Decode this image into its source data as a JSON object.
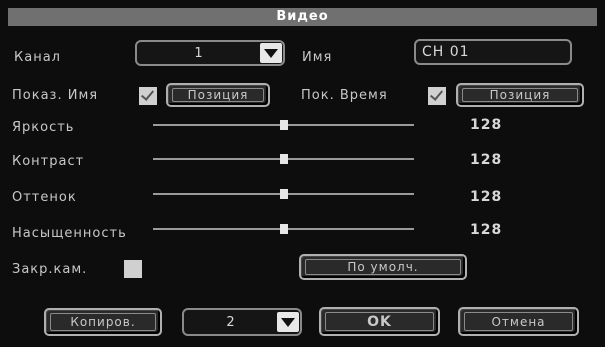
{
  "title": "Видео",
  "channel": {
    "label": "Канал",
    "value": "1"
  },
  "name": {
    "label": "Имя",
    "value": "CH 01"
  },
  "show_name": {
    "label": "Показ. Имя",
    "checked": true,
    "position_button": "Позиция"
  },
  "show_time": {
    "label": "Пок. Время",
    "checked": true,
    "position_button": "Позиция"
  },
  "sliders": [
    {
      "label": "Яркость",
      "value": "128",
      "level": 0.5
    },
    {
      "label": "Контраст",
      "value": "128",
      "level": 0.5
    },
    {
      "label": "Оттенок",
      "value": "128",
      "level": 0.5
    },
    {
      "label": "Насыщенность",
      "value": "128",
      "level": 0.5
    }
  ],
  "mask": {
    "label": "Закр.кам.",
    "checked": false
  },
  "default_button": "По умолч.",
  "footer": {
    "copy_button": "Копиров.",
    "copy_target": "2",
    "ok_button": "OK",
    "cancel_button": "Отмена"
  },
  "colors": {
    "background": "#0d0d0d",
    "title_bar": "#707070",
    "text": "#c8c8c8"
  }
}
